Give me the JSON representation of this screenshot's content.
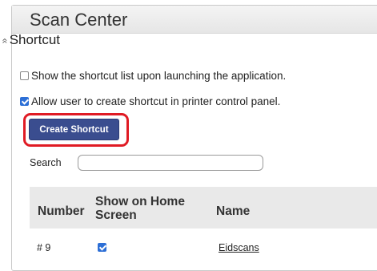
{
  "window": {
    "title": "Scan Center"
  },
  "section": {
    "title": "Shortcut",
    "collapse_glyph": "«"
  },
  "options": [
    {
      "label": "Show the shortcut list upon launching the application.",
      "checked": false
    },
    {
      "label": "Allow user to create shortcut in printer control panel.",
      "checked": true
    }
  ],
  "create_button": {
    "label": "Create Shortcut",
    "highlight_color": "#e01b24",
    "button_color": "#3a4d8f"
  },
  "search": {
    "label": "Search",
    "value": ""
  },
  "table": {
    "columns": [
      "Number",
      "Show on Home Screen",
      "Name"
    ],
    "rows": [
      {
        "number": "# 9",
        "show_on_home": true,
        "name": "Eidscans"
      }
    ]
  }
}
